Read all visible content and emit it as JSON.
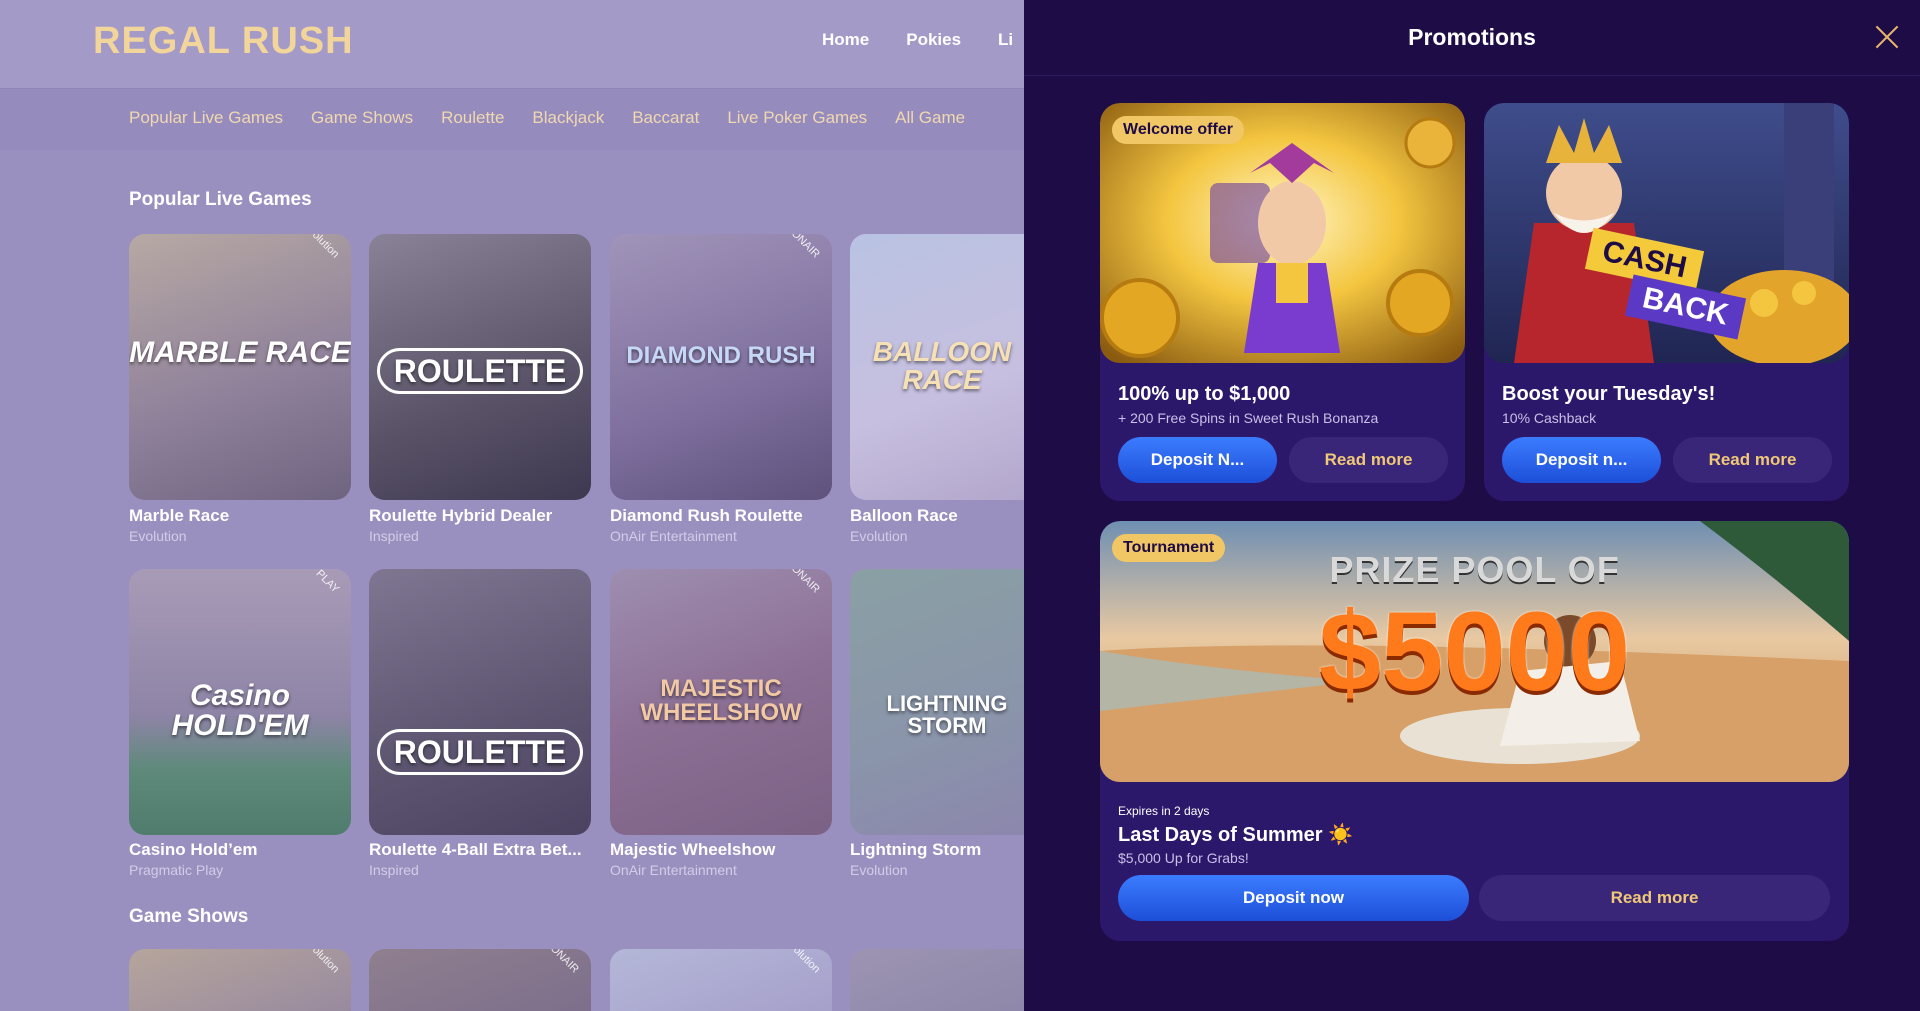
{
  "site": {
    "logo": "REGAL RUSH",
    "nav": [
      "Home",
      "Pokies",
      "Li"
    ],
    "subnav": [
      "Popular Live Games",
      "Game Shows",
      "Roulette",
      "Blackjack",
      "Baccarat",
      "Live Poker Games",
      "All Game"
    ],
    "sections": {
      "popular": "Popular Live Games",
      "gameshows": "Game Shows"
    },
    "row1": [
      {
        "name": "Marble Race",
        "provider": "Evolution",
        "art": "MARBLE RACE",
        "badge": "Evolution"
      },
      {
        "name": "Roulette Hybrid Dealer",
        "provider": "Inspired",
        "art": "ROULETTE",
        "badge": ""
      },
      {
        "name": "Diamond Rush Roulette",
        "provider": "OnAir Entertainment",
        "art": "DIAMOND RUSH",
        "badge": "ONAIR"
      },
      {
        "name": "Balloon Race",
        "provider": "Evolution",
        "art": "BALLOON RACE",
        "badge": ""
      }
    ],
    "row2": [
      {
        "name": "Casino Hold’em",
        "provider": "Pragmatic Play",
        "art": "Casino HOLD'EM",
        "badge": "PLAY"
      },
      {
        "name": "Roulette 4-Ball Extra Bet...",
        "provider": "Inspired",
        "art": "ROULETTE",
        "badge": ""
      },
      {
        "name": "Majestic Wheelshow",
        "provider": "OnAir Entertainment",
        "art": "MAJESTIC WHEELSHOW",
        "badge": "ONAIR"
      },
      {
        "name": "Lightning Storm",
        "provider": "Evolution",
        "art": "LIGHTNING STORM",
        "badge": ""
      }
    ],
    "row3_badges": [
      "Evolution",
      "ONAIR",
      "Evolution",
      ""
    ]
  },
  "promotions": {
    "title": "Promotions",
    "welcome": {
      "badge": "Welcome offer",
      "title": "100% up to $1,000",
      "subtitle": "+ 200 Free Spins in Sweet Rush Bonanza",
      "deposit_label": "Deposit N...",
      "read_more": "Read more"
    },
    "cashback": {
      "art_line1": "CASH",
      "art_line2": "BACK",
      "title": "Boost your Tuesday's!",
      "subtitle": "10% Cashback",
      "deposit_label": "Deposit n...",
      "read_more": "Read more"
    },
    "tournament": {
      "badge": "Tournament",
      "art_line1": "PRIZE POOL OF",
      "art_line2": "$5000",
      "expires": "Expires in 2 days",
      "title": "Last Days of Summer ☀️",
      "subtitle": "$5,000 Up for Grabs!",
      "deposit_label": "Deposit now",
      "read_more": "Read more"
    }
  },
  "colors": {
    "panel_bg": "#1d0c45",
    "card_bg": "#2c186a",
    "accent_gold": "#f1c765",
    "primary_blue": "#2f6af0"
  }
}
